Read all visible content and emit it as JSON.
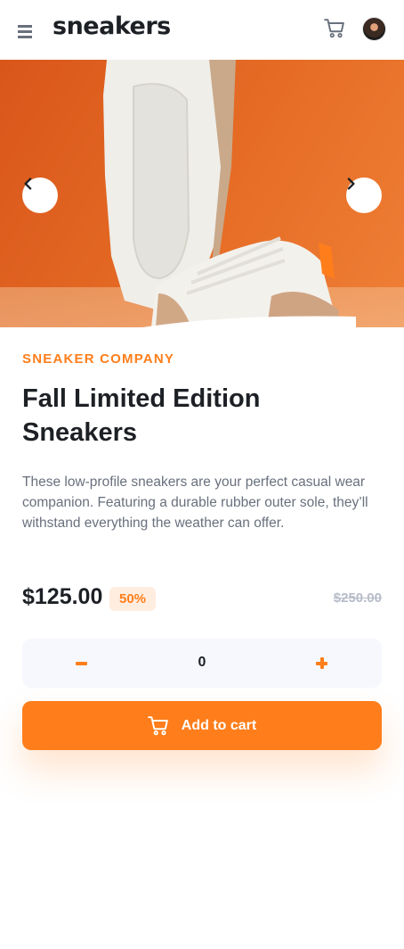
{
  "header": {
    "logo": "sneakers",
    "menu_icon": "hamburger-menu-icon",
    "cart_icon": "cart-icon",
    "avatar_icon": "user-avatar"
  },
  "gallery": {
    "prev_icon": "chevron-left-icon",
    "next_icon": "chevron-right-icon",
    "image_subject": "white and beige sneakers on orange background"
  },
  "product": {
    "company": "SNEAKER COMPANY",
    "title": "Fall Limited Edition Sneakers",
    "description": "These low-profile sneakers are your perfect casual wear companion. Featuring a durable rubber outer sole, they’ll withstand everything the weather can offer.",
    "price": "$125.00",
    "discount": "50%",
    "old_price": "$250.00"
  },
  "quantity": {
    "value": "0",
    "minus_icon": "minus-icon",
    "plus_icon": "plus-icon"
  },
  "add_to_cart": {
    "label": "Add to cart",
    "icon": "cart-icon"
  },
  "colors": {
    "accent": "#ff7e1b",
    "accent_pale": "#ffede0",
    "dark_text": "#1d2025",
    "muted_text": "#69707d",
    "strike_text": "#b6bcc8",
    "qty_bg": "#f6f8fd"
  }
}
